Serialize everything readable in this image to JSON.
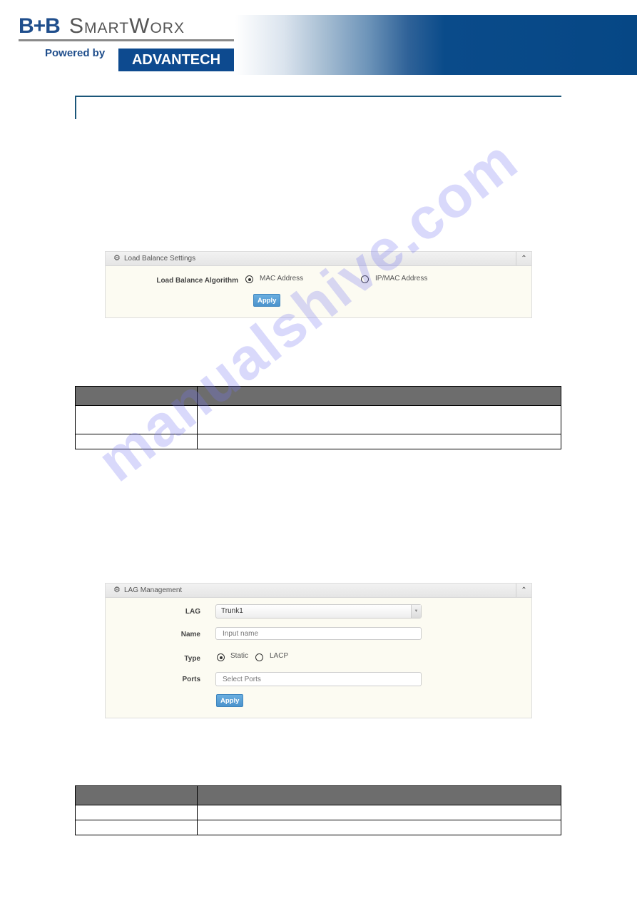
{
  "header": {
    "brand_bb": "B+B",
    "brand_name": "SmartWorx",
    "powered_by": "Powered by",
    "partner": "ADVANTECH",
    "colors": {
      "brand_blue": "#1f4e8c",
      "band_dark": "#064785"
    }
  },
  "load_balance_panel": {
    "title": "Load Balance Settings",
    "icon": "gear-icon",
    "collapse_icon": "chevron-up-icon",
    "algorithm_label": "Load Balance Algorithm",
    "options": [
      {
        "label": "MAC Address",
        "checked": true
      },
      {
        "label": "IP/MAC Address",
        "checked": false
      }
    ],
    "apply_label": "Apply"
  },
  "table1": {
    "header": [
      "",
      ""
    ],
    "rows": [
      [
        "",
        ""
      ],
      [
        "",
        ""
      ]
    ]
  },
  "lag_panel": {
    "title": "LAG Management",
    "icon": "gear-icon",
    "collapse_icon": "chevron-up-icon",
    "lag_label": "LAG",
    "lag_value": "Trunk1",
    "name_label": "Name",
    "name_placeholder": "Input name",
    "type_label": "Type",
    "type_options": [
      {
        "label": "Static",
        "checked": true
      },
      {
        "label": "LACP",
        "checked": false
      }
    ],
    "ports_label": "Ports",
    "ports_placeholder": "Select Ports",
    "apply_label": "Apply"
  },
  "table2": {
    "header": [
      "",
      ""
    ],
    "rows": [
      [
        "",
        ""
      ],
      [
        "",
        ""
      ]
    ]
  },
  "watermark": "manualshive.com"
}
